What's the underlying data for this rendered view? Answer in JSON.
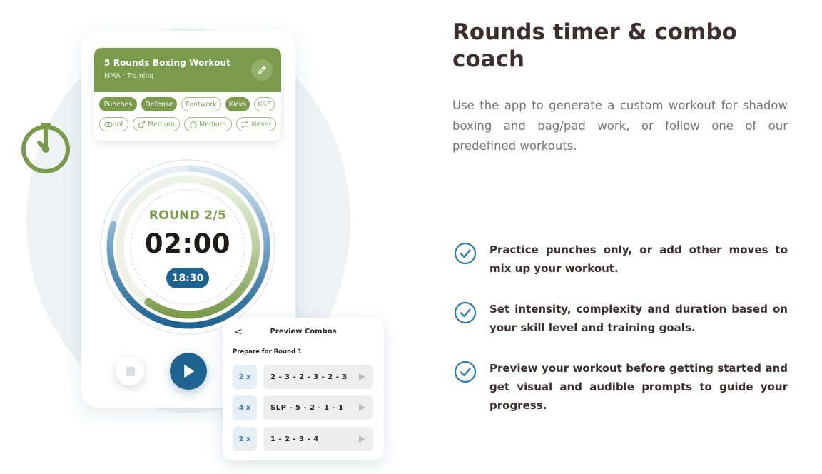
{
  "colors": {
    "brand_green": "#7b9b4c",
    "brand_blue": "#1f6391",
    "heading": "#3d2f2f",
    "body_text": "#777777",
    "background_circle": "#eef2f5"
  },
  "decor": {
    "timer_icon": "stopwatch-icon"
  },
  "phone": {
    "workout": {
      "title": "5 Rounds Boxing Workout",
      "subtitle": "MMA · Training",
      "edit_icon": "pencil-icon",
      "moves": [
        {
          "label": "Punches",
          "selected": true
        },
        {
          "label": "Defense",
          "selected": true
        },
        {
          "label": "Footwork",
          "selected": false
        },
        {
          "label": "Kicks",
          "selected": true
        },
        {
          "label": "K&E",
          "selected": false
        }
      ],
      "settings": [
        {
          "icon": "level-icon",
          "label": "Int"
        },
        {
          "icon": "intensity-icon",
          "label": "Medium"
        },
        {
          "icon": "drop-icon",
          "label": "Medium"
        },
        {
          "icon": "repeat-icon",
          "label": "Never"
        }
      ]
    },
    "timer": {
      "round_label": "ROUND 2/5",
      "round_time": "02:00",
      "total_remaining": "18:30"
    },
    "controls": {
      "stop_icon": "stop-icon",
      "play_icon": "play-icon"
    }
  },
  "preview": {
    "back_label": "<",
    "title": "Preview Combos",
    "prepare_label": "Prepare for Round 1",
    "combos": [
      {
        "multiplier": "2 x",
        "sequence": "2 - 3 - 2 - 3 - 2 - 3"
      },
      {
        "multiplier": "4 x",
        "sequence": "SLP - 5 - 2 - 1 - 1"
      },
      {
        "multiplier": "2 x",
        "sequence": "1 - 2 - 3 - 4"
      }
    ]
  },
  "content": {
    "heading": "Rounds timer & combo coach",
    "description": "Use the app to generate a custom workout for shadow boxing and bag/pad work, or follow one of our predefined workouts.",
    "features": [
      {
        "icon": "check-circle-icon",
        "text": "Practice punches only, or add other moves to mix up your workout."
      },
      {
        "icon": "check-circle-icon",
        "text": "Set intensity, complexity and duration based on your skill level and training goals."
      },
      {
        "icon": "check-circle-icon",
        "text": "Preview your workout before getting started and get visual and audible prompts to guide your progress."
      }
    ]
  }
}
